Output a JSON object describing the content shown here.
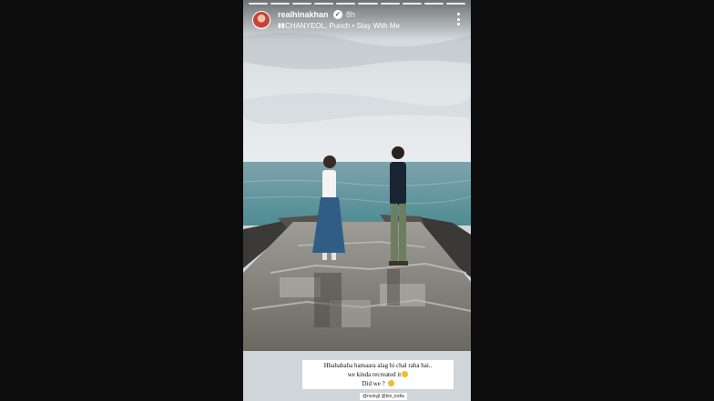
{
  "story": {
    "username": "realhinakhan",
    "time": "8h",
    "song": "CHANYEOL, Punch • Stay With Me",
    "caption_lines": [
      "Hhahahaha hamaara alag hi chal raha hai..",
      "we kinda recreated it",
      "Did we ?"
    ],
    "tags": "@rockyjl @kto_india"
  }
}
